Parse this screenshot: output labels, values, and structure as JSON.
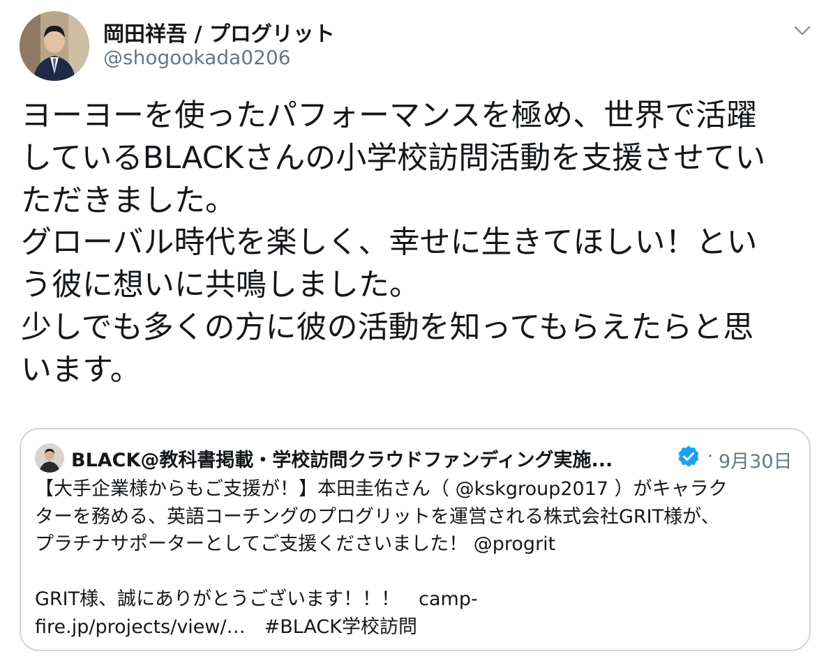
{
  "author": {
    "display_name": "岡田祥吾 / プログリット",
    "handle": "@shogookada0206",
    "avatar": "profile-photo"
  },
  "tweet": {
    "lines": [
      "ヨーヨーを使ったパフォーマンスを極め、世界で活躍",
      "しているBLACKさんの小学校訪問活動を支援させてい",
      "ただきました。",
      "グローバル時代を楽しく、幸せに生きてほしい！とい",
      "う彼に想いに共鳴しました。",
      "少しでも多くの方に彼の活動を知ってもらえたらと思",
      "います。"
    ]
  },
  "quoted_tweet": {
    "display_name": "BLACK@教科書掲載・学校訪問クラウドファンディング実施...",
    "separator": "·",
    "date": "9月30日",
    "lines": [
      "【大手企業様からもご支援が！】本田圭佑さん（ @kskgroup2017 ）がキャラク",
      "ターを務める、英語コーチングのプログリットを運営される株式会社GRIT様が、",
      "プラチナサポーターとしてご支援くださいました！ @progrit",
      "",
      "GRIT様、誠にありがとうございます！！！　camp-",
      "fire.jp/projects/view/…　#BLACK学校訪問"
    ]
  },
  "icons": {
    "caret": "chevron-down-icon",
    "verified": "verified-badge-icon"
  },
  "colors": {
    "text": "#14171a",
    "secondary": "#657786",
    "border": "#ccd6dd",
    "verified": "#1da1f2"
  }
}
